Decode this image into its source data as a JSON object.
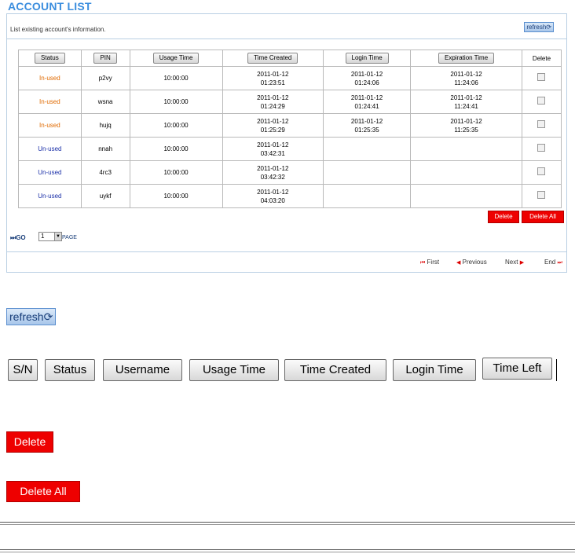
{
  "title": "ACCOUNT LIST",
  "description": "List existing account's information.",
  "refresh_label": "refresh",
  "columns": [
    "Status",
    "PIN",
    "Usage Time",
    "Time Created",
    "Login Time",
    "Expiration Time",
    "Delete"
  ],
  "rows": [
    {
      "status": "In-used",
      "pin": "p2vy",
      "usage": "10:00:00",
      "created": [
        "2011-01-12",
        "01:23:51"
      ],
      "login": [
        "2011-01-12",
        "01:24:06"
      ],
      "expiration": [
        "2011-01-12",
        "11:24:06"
      ]
    },
    {
      "status": "In-used",
      "pin": "wsna",
      "usage": "10:00:00",
      "created": [
        "2011-01-12",
        "01:24:29"
      ],
      "login": [
        "2011-01-12",
        "01:24:41"
      ],
      "expiration": [
        "2011-01-12",
        "11:24:41"
      ]
    },
    {
      "status": "In-used",
      "pin": "hujq",
      "usage": "10:00:00",
      "created": [
        "2011-01-12",
        "01:25:29"
      ],
      "login": [
        "2011-01-12",
        "01:25:35"
      ],
      "expiration": [
        "2011-01-12",
        "11:25:35"
      ]
    },
    {
      "status": "Un-used",
      "pin": "nnah",
      "usage": "10:00:00",
      "created": [
        "2011-01-12",
        "03:42:31"
      ],
      "login": [
        "",
        ""
      ],
      "expiration": [
        "",
        ""
      ]
    },
    {
      "status": "Un-used",
      "pin": "4rc3",
      "usage": "10:00:00",
      "created": [
        "2011-01-12",
        "03:42:32"
      ],
      "login": [
        "",
        ""
      ],
      "expiration": [
        "",
        ""
      ]
    },
    {
      "status": "Un-used",
      "pin": "uykf",
      "usage": "10:00:00",
      "created": [
        "2011-01-12",
        "04:03:20"
      ],
      "login": [
        "",
        ""
      ],
      "expiration": [
        "",
        ""
      ]
    }
  ],
  "delete_label": "Delete",
  "delete_all_label": "Delete All",
  "go_label": "GO",
  "page_value": "1",
  "page_word": "PAGE",
  "nav": {
    "first": "First",
    "previous": "Previous",
    "next": "Next",
    "end": "End"
  },
  "legend_buttons": [
    "S/N",
    "Status",
    "Username",
    "Usage Time",
    "Time Created",
    "Login Time",
    "Time Left"
  ],
  "colors": {
    "title": "#3a8dde",
    "in_used": "#e06a00",
    "un_used": "#1a2fa8",
    "delete": "#ee0000"
  },
  "icons": {
    "refresh": "refresh-cycle-icon",
    "go": "fast-forward-icon",
    "first": "first-page-icon",
    "previous": "previous-icon",
    "next": "next-icon",
    "end": "last-page-icon",
    "dropdown": "chevron-down-icon"
  }
}
